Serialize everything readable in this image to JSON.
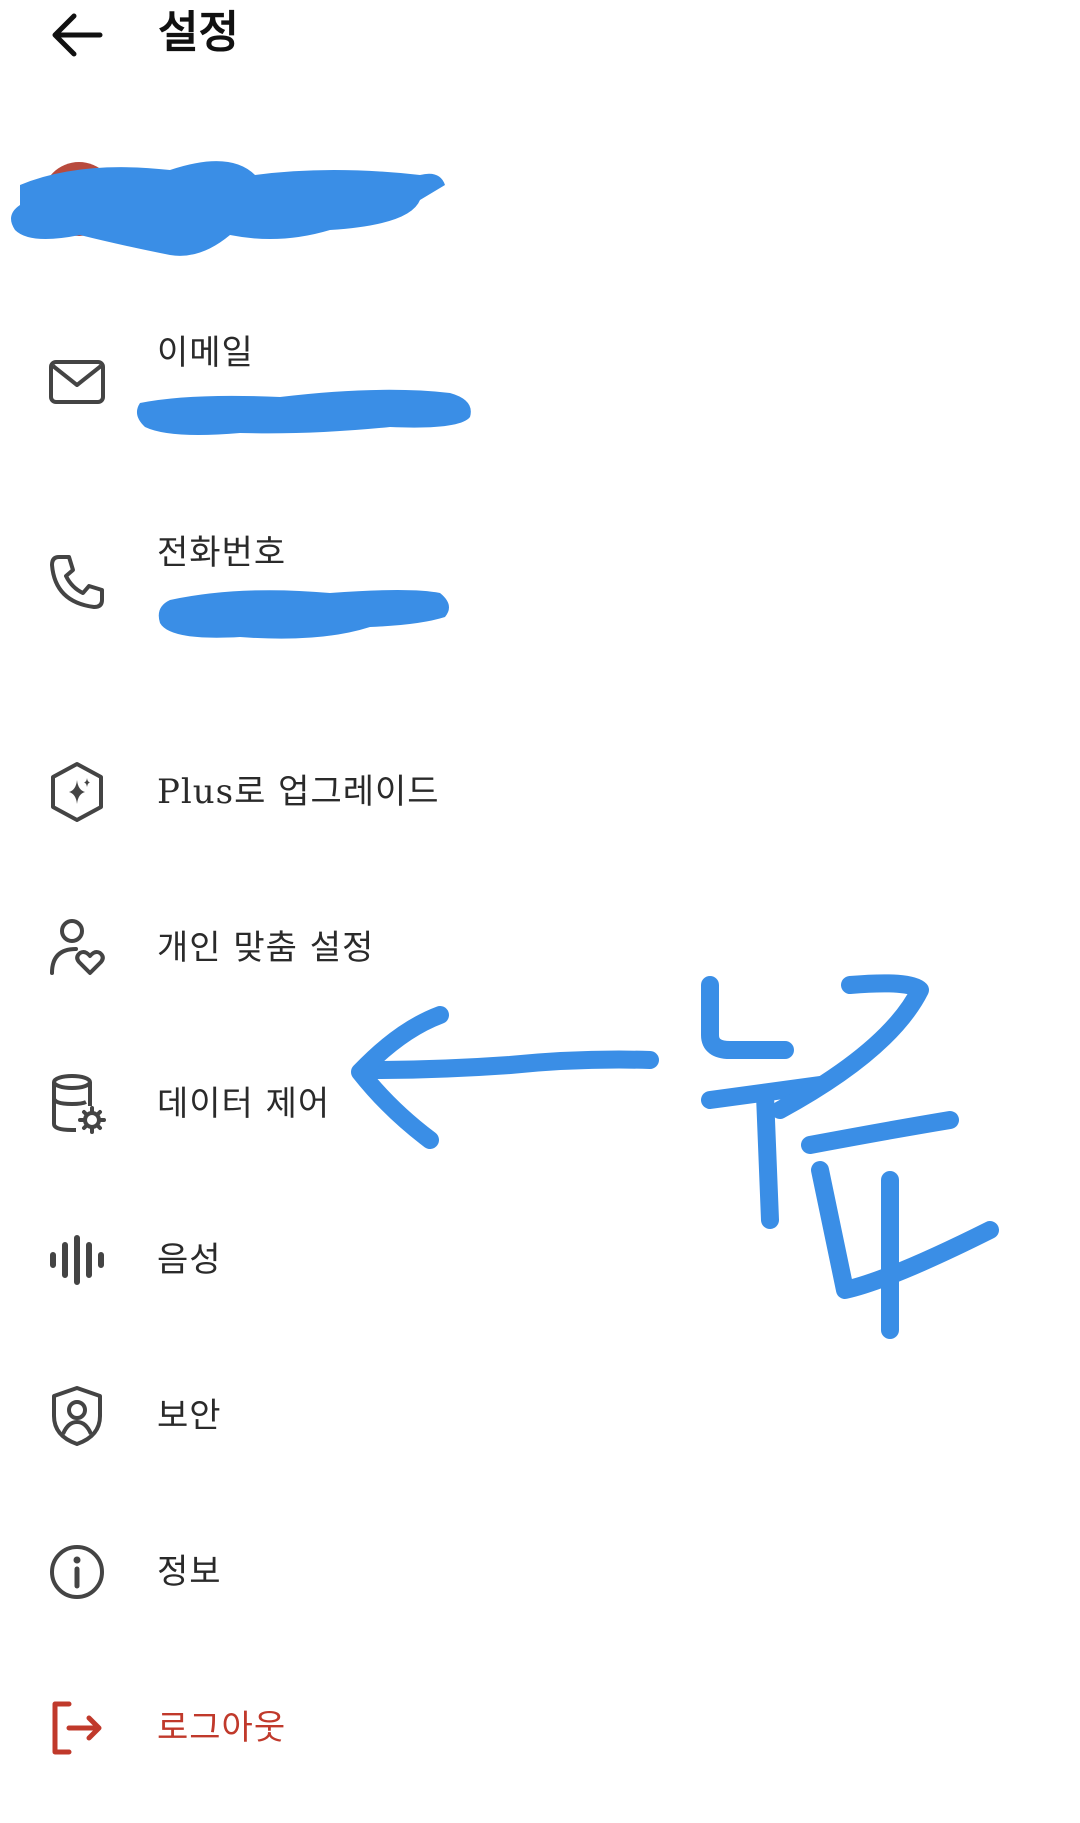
{
  "header": {
    "title": "설정",
    "back_icon": "arrow-left-icon"
  },
  "profile": {
    "name": "",
    "avatar_color": "#b84a3d"
  },
  "items": [
    {
      "key": "email",
      "label": "이메일",
      "value": "",
      "icon": "mail-icon"
    },
    {
      "key": "phone",
      "label": "전화번호",
      "value": "",
      "icon": "phone-icon"
    },
    {
      "key": "upgrade",
      "label": "Plus로 업그레이드",
      "icon": "sparkle-hexagon-icon"
    },
    {
      "key": "personalization",
      "label": "개인 맞춤 설정",
      "icon": "person-heart-icon"
    },
    {
      "key": "data_controls",
      "label": "데이터 제어",
      "icon": "database-gear-icon"
    },
    {
      "key": "voice",
      "label": "음성",
      "icon": "voice-waveform-icon"
    },
    {
      "key": "security",
      "label": "보안",
      "icon": "shield-user-icon"
    },
    {
      "key": "about",
      "label": "정보",
      "icon": "info-icon"
    },
    {
      "key": "logout",
      "label": "로그아웃",
      "icon": "logout-icon"
    }
  ],
  "colors": {
    "accent_annotation": "#3a8ee6",
    "logout": "#c0392b",
    "text": "#2a2a2a",
    "icon": "#444444"
  }
}
